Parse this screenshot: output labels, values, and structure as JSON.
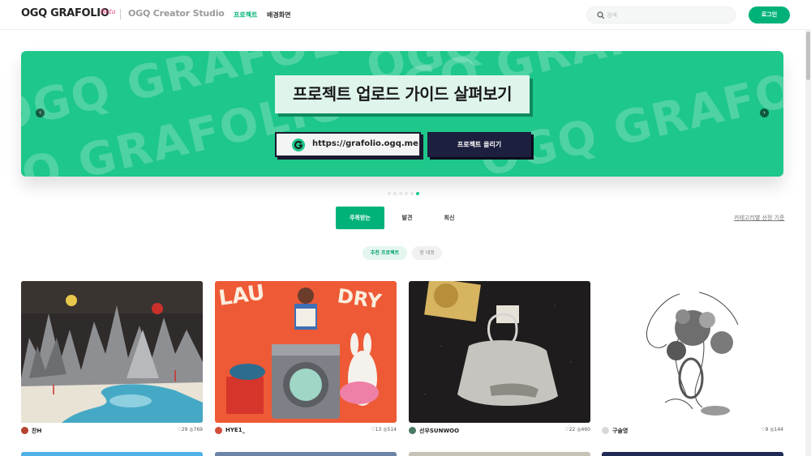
{
  "header": {
    "logo": "OGQ GRAFOLIO",
    "beta": "Beta",
    "studio": "OGQ Creator Studio",
    "nav": [
      "프로젝트",
      "배경화면"
    ],
    "search_placeholder": "검색",
    "login": "로그인"
  },
  "banner": {
    "watermark": "OGQ GRAFOLIO OGQ GRAFOLIO",
    "title": "프로젝트 업로드 가이드 살펴보기",
    "url": "https://grafolio.ogq.me",
    "upload": "프로젝트 올리기",
    "prev": "‹",
    "next": "›"
  },
  "tabs": [
    "주목받는",
    "발견",
    "최신"
  ],
  "category_link": "카테고리별 선정 기준",
  "chips": [
    "추천 프로젝트",
    "핫 데뷔"
  ],
  "cards": [
    {
      "author": "찬H",
      "likes": "29",
      "views": "769"
    },
    {
      "author": "HYE1_",
      "likes": "13",
      "views": "514"
    },
    {
      "author": "선우SUNWOO",
      "likes": "22",
      "views": "460"
    },
    {
      "author": "구슬영",
      "likes": "9",
      "views": "144"
    }
  ],
  "colors": {
    "accent": "#00b27a",
    "banner": "#1ec78a"
  }
}
